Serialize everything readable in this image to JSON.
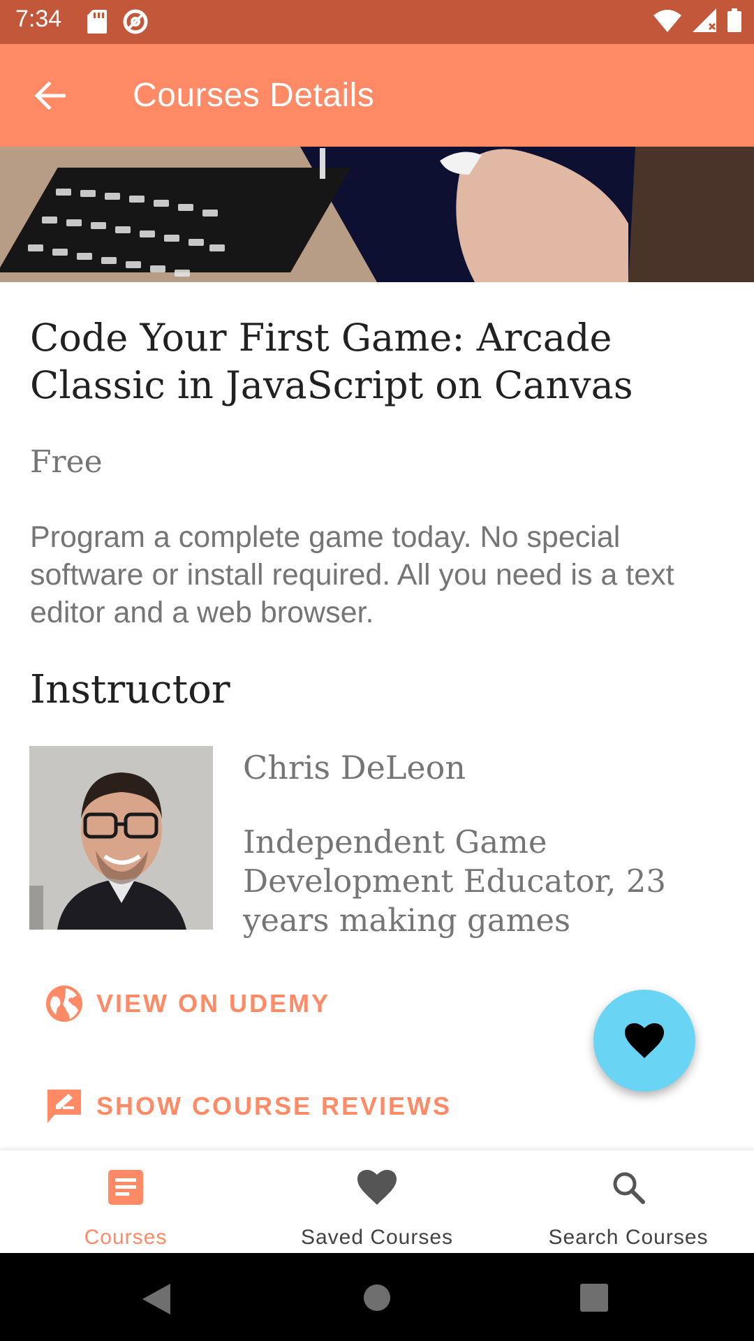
{
  "status_bar": {
    "time": "7:34"
  },
  "app_bar": {
    "title": "Courses Details"
  },
  "course": {
    "title": "Code Your First Game: Arcade Classic in JavaScript on Canvas",
    "price": "Free",
    "description": "Program a complete game today. No special software or install required. All you need is a text editor and a web browser."
  },
  "instructor": {
    "heading": "Instructor",
    "name": "Chris DeLeon",
    "bio": "Independent Game Development Educator, 23 years making games"
  },
  "actions": {
    "view_label": "VIEW ON UDEMY",
    "reviews_label": "SHOW COURSE REVIEWS"
  },
  "bottom_nav": {
    "items": [
      {
        "label": "Courses",
        "icon": "list-icon",
        "active": true
      },
      {
        "label": "Saved Courses",
        "icon": "heart-icon",
        "active": false
      },
      {
        "label": "Search Courses",
        "icon": "search-icon",
        "active": false
      }
    ]
  },
  "colors": {
    "accent": "#ff8a65",
    "status_bar": "#c2573a",
    "fab": "#6ad4f4"
  }
}
